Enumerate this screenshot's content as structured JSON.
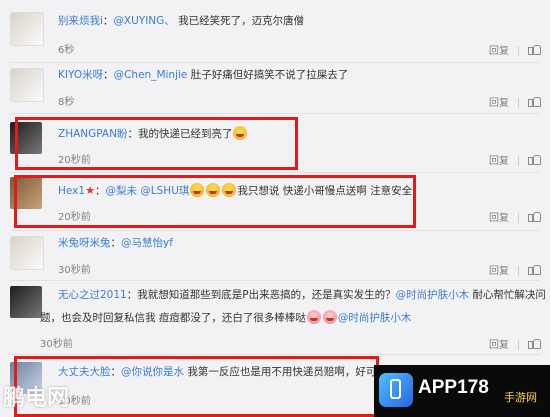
{
  "actions": {
    "reply_label": "回复"
  },
  "comments": [
    {
      "name": "别来烦我i",
      "text_before": "：",
      "mention": "@XUYING、",
      "text_after": " 我已经笑死了，迈克尔唐僧",
      "time": "6秒"
    },
    {
      "name": "KIYO米呀",
      "text_before": "：",
      "mention": "@Chen_Minjie",
      "text_after": " 肚子好痛但好搞笑不说了拉屎去了",
      "time": "8秒"
    },
    {
      "name": "ZHANGPAN盼",
      "text_before": "：我的快递已经到亮了",
      "mention": "",
      "text_after": "",
      "time": "20秒前"
    },
    {
      "name": "Hex1",
      "text_before": "：",
      "mention": "@梨未 @LSHU琪",
      "text_after": "我只想说 快递小哥慢点送啊 注意安全",
      "time": "20秒前"
    },
    {
      "name": "米兔呀米兔",
      "text_before": "：",
      "mention": "@马慧怡yf",
      "text_after": "",
      "time": "30秒前"
    },
    {
      "name": "无心之过2011",
      "text_before": "：我就想知道那些到底是P出来恶搞的，还是真实发生的？",
      "mention": "@时尚护肤小木",
      "text_after": " 耐心帮忙解决问",
      "line2_before": "题，也会及时回复私信我 痘痘都没了，还白了很多棒棒哒",
      "line2_mention": "@时尚护肤小木",
      "time": "30秒前"
    },
    {
      "name": "大丈夫大脸",
      "text_before": "：",
      "mention": "@你说你是水",
      "text_after": " 我第一反应也是用不用快递员赔啊，好可怜",
      "time": "30秒前"
    }
  ],
  "watermark": {
    "left": "鹏电网",
    "main": "APP178",
    "sub": "手游网"
  },
  "colors": {
    "link": "#3b7bd1",
    "highlight": "#e31a1a",
    "background": "#f2f2f5"
  }
}
